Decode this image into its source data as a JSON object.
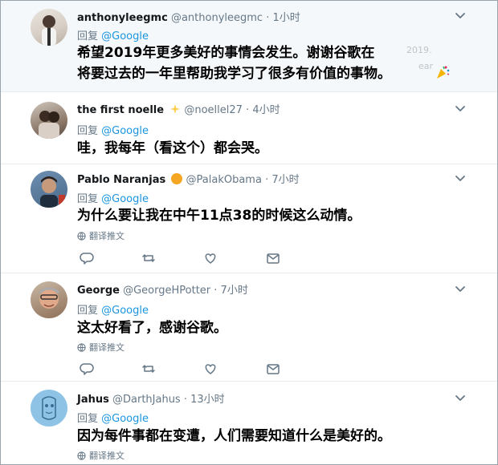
{
  "tweets": [
    {
      "name": "anthonyleegmc",
      "handle": "@anthonyleegmc",
      "time": "· 1小时",
      "reply_prefix": "回复",
      "reply_to": "@Google",
      "text_lines": [
        "希望2019年更多美好的事情会发生。谢谢谷歌在",
        "将要过去的一年里帮助我学习了很多有价值的事物。"
      ]
    },
    {
      "name": "the first noelle",
      "handle": "@noellel27",
      "time": "· 4小时",
      "reply_prefix": "回复",
      "reply_to": "@Google",
      "text_lines": [
        "哇，我每年（看这个）都会哭。"
      ]
    },
    {
      "name": "Pablo Naranjas",
      "handle": "@PalakObama",
      "time": "· 7小时",
      "reply_prefix": "回复",
      "reply_to": "@Google",
      "text_lines": [
        "为什么要让我在中午11点38的时候这么动情。"
      ],
      "translate_label": "翻译推文"
    },
    {
      "name": "George",
      "handle": "@GeorgeHPotter",
      "time": "· 7小时",
      "reply_prefix": "回复",
      "reply_to": "@Google",
      "text_lines": [
        "这太好看了，感谢谷歌。"
      ],
      "translate_label": "翻译推文"
    },
    {
      "name": "Jahus",
      "handle": "@DarthJahus",
      "time": "· 13小时",
      "reply_prefix": "回复",
      "reply_to": "@Google",
      "text_lines": [
        "因为每件事都在变遭，人们需要知道什么是美好的。"
      ],
      "translate_label": "翻译推文"
    }
  ],
  "ghost_text": {
    "line1": "2019.",
    "line2": "ear"
  },
  "colors": {
    "link": "#1b95e0",
    "muted": "#657786",
    "divider": "#e6ecf0",
    "selected_bg": "#f5f8fa"
  },
  "icons": [
    "chevron-down-icon",
    "reply-icon",
    "retweet-icon",
    "like-icon",
    "message-icon",
    "globe-icon",
    "party-popper-icon",
    "sparkles-icon",
    "orange-icon"
  ]
}
